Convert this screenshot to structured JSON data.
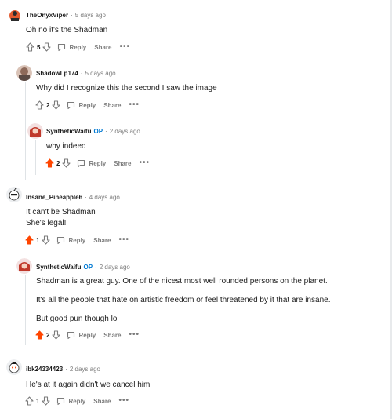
{
  "actions": {
    "reply": "Reply",
    "share": "Share",
    "more": "•••"
  },
  "comments": [
    {
      "user": "TheOnyxViper",
      "op": "",
      "time": "5 days ago",
      "lines": [
        "Oh no it's the Shadman"
      ],
      "votes": "5",
      "upvoted": false
    },
    {
      "user": "ShadowLp174",
      "op": "",
      "time": "5 days ago",
      "lines": [
        "Why did I recognize this the second I saw the image"
      ],
      "votes": "2",
      "upvoted": false
    },
    {
      "user": "SyntheticWaifu",
      "op": "OP",
      "time": "2 days ago",
      "lines": [
        "why indeed"
      ],
      "votes": "2",
      "upvoted": true
    },
    {
      "user": "Insane_Pineapple6",
      "op": "",
      "time": "4 days ago",
      "lines": [
        "It can't be Shadman",
        "She's legal!"
      ],
      "votes": "1",
      "upvoted": true
    },
    {
      "user": "SyntheticWaifu",
      "op": "OP",
      "time": "2 days ago",
      "lines": [
        "Shadman is a great guy. One of the nicest most well rounded persons on the planet.",
        "It's all the people that hate on artistic freedom or feel threatened by it that are insane.",
        "But good pun though lol"
      ],
      "votes": "2",
      "upvoted": true
    },
    {
      "user": "ibk24334423",
      "op": "",
      "time": "2 days ago",
      "lines": [
        "He's at it again didn't we cancel him"
      ],
      "votes": "1",
      "upvoted": false
    }
  ],
  "colors": {
    "upvote": "#ff4500",
    "meta": "#7c7c7c",
    "op": "#0079d3"
  }
}
